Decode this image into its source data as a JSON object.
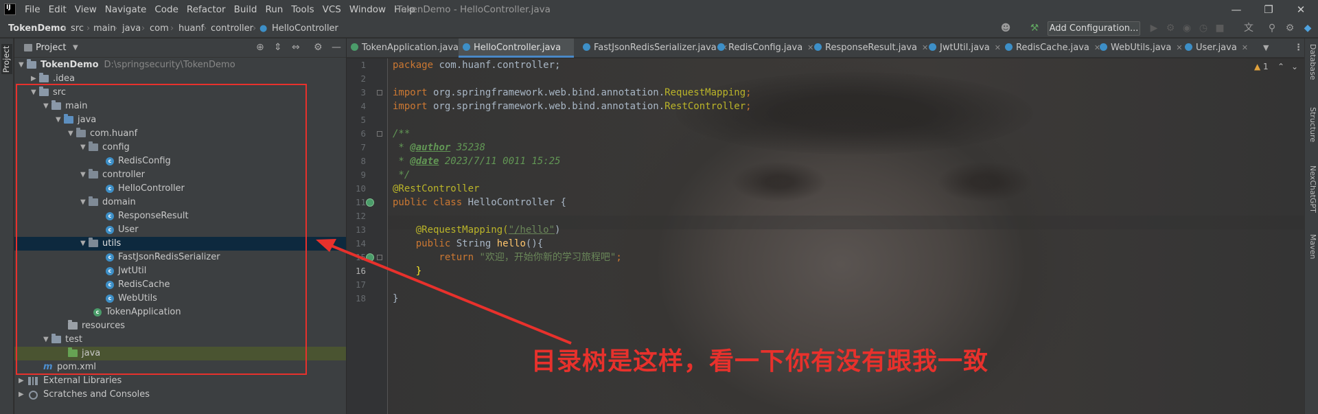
{
  "app": {
    "logo": "IJ",
    "window_title": "TokenDemo - HelloController.java"
  },
  "menu": [
    "File",
    "Edit",
    "View",
    "Navigate",
    "Code",
    "Refactor",
    "Build",
    "Run",
    "Tools",
    "VCS",
    "Window",
    "Help"
  ],
  "breadcrumbs": {
    "project": "TokenDemo",
    "parts": [
      "src",
      "main",
      "java",
      "com",
      "huanf",
      "controller"
    ],
    "file": "HelloController"
  },
  "toolbar": {
    "add_configuration": "Add Configuration..."
  },
  "project_panel": {
    "title": "Project",
    "tree": [
      {
        "label": "TokenDemo",
        "path": "D:\\springsecurity\\TokenDemo",
        "icon": "module-folder"
      },
      {
        "label": ".idea",
        "icon": "folder"
      },
      {
        "label": "src",
        "icon": "folder"
      },
      {
        "label": "main",
        "icon": "folder"
      },
      {
        "label": "java",
        "icon": "source-folder"
      },
      {
        "label": "com.huanf",
        "icon": "package"
      },
      {
        "label": "config",
        "icon": "package"
      },
      {
        "label": "RedisConfig",
        "icon": "class"
      },
      {
        "label": "controller",
        "icon": "package"
      },
      {
        "label": "HelloController",
        "icon": "class"
      },
      {
        "label": "domain",
        "icon": "package"
      },
      {
        "label": "ResponseResult",
        "icon": "class"
      },
      {
        "label": "User",
        "icon": "class"
      },
      {
        "label": "utils",
        "icon": "package"
      },
      {
        "label": "FastJsonRedisSerializer",
        "icon": "class"
      },
      {
        "label": "JwtUtil",
        "icon": "class"
      },
      {
        "label": "RedisCache",
        "icon": "class"
      },
      {
        "label": "WebUtils",
        "icon": "class"
      },
      {
        "label": "TokenApplication",
        "icon": "spring-class"
      },
      {
        "label": "resources",
        "icon": "resources-folder"
      },
      {
        "label": "test",
        "icon": "folder"
      },
      {
        "label": "java",
        "icon": "test-folder"
      },
      {
        "label": "pom.xml",
        "icon": "maven"
      },
      {
        "label": "External Libraries",
        "icon": "library"
      },
      {
        "label": "Scratches and Consoles",
        "icon": "scratches"
      }
    ]
  },
  "tabs": [
    {
      "label": "TokenApplication.java",
      "active": false
    },
    {
      "label": "HelloController.java",
      "active": true
    },
    {
      "label": "FastJsonRedisSerializer.java",
      "active": false
    },
    {
      "label": "RedisConfig.java",
      "active": false
    },
    {
      "label": "ResponseResult.java",
      "active": false
    },
    {
      "label": "JwtUtil.java",
      "active": false
    },
    {
      "label": "RedisCache.java",
      "active": false
    },
    {
      "label": "WebUtils.java",
      "active": false
    },
    {
      "label": "User.java",
      "active": false
    }
  ],
  "editor": {
    "warnings": "1",
    "current_line": "16",
    "line_numbers": [
      "1",
      "2",
      "3",
      "4",
      "5",
      "6",
      "7",
      "8",
      "9",
      "10",
      "11",
      "12",
      "13",
      "14",
      "15",
      "16",
      "17",
      "18"
    ],
    "code": {
      "l1_kw": "package",
      "l1": " com.huanf.controller;",
      "l3_kw": "import",
      "l3a": " org.springframework.web.bind.annotation.",
      "l3b": "RequestMapping",
      "l3c": ";",
      "l4_kw": "import",
      "l4a": " org.springframework.web.bind.annotation.",
      "l4b": "RestController",
      "l4c": ";",
      "l6": "/**",
      "l7a": " * ",
      "l7tag": "@author",
      "l7b": " 35238",
      "l8a": " * ",
      "l8tag": "@date",
      "l8b": " 2023/7/11 0011 15:25",
      "l9": " */",
      "l10": "@RestController",
      "l11_kw": "public class",
      "l11": " HelloController {",
      "l13_ann": "    @RequestMapping(",
      "l13_str": "\"/hello\"",
      "l13_end": ")",
      "l14_kw": "    public",
      "l14a": " String ",
      "l14fn": "hello",
      "l14b": "(){",
      "l15_kw": "        return",
      "l15_str": " \"欢迎，开始你新的学习旅程吧\"",
      "l15_end": ";",
      "l16": "    }",
      "l18": "}"
    }
  },
  "right_panel": [
    "Database",
    "Structure",
    "NexChatGPT",
    "Maven"
  ],
  "annotation": {
    "text": "目录树是这样，看一下你有没有跟我一致",
    "color": "#e8312c"
  }
}
